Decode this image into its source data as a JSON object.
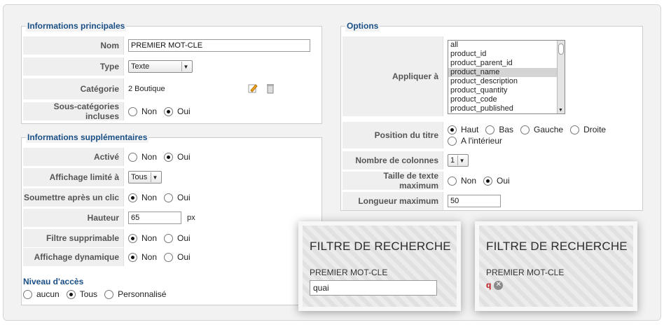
{
  "main_info": {
    "legend": "Informations principales",
    "name_label": "Nom",
    "name_value": "PREMIER MOT-CLE",
    "type_label": "Type",
    "type_value": "Texte",
    "category_label": "Catégorie",
    "category_value": "2 Boutique",
    "subcat_label": "Sous-catégories incluses",
    "subcat_no": "Non",
    "subcat_yes": "Oui"
  },
  "extra_info": {
    "legend": "Informations supplémentaires",
    "active_label": "Activé",
    "active_no": "Non",
    "active_yes": "Oui",
    "limit_label": "Affichage limité à",
    "limit_value": "Tous",
    "submit_label": "Soumettre après un clic",
    "submit_no": "Non",
    "submit_yes": "Oui",
    "height_label": "Hauteur",
    "height_value": "65",
    "height_unit": "px",
    "removable_label": "Filtre supprimable",
    "removable_no": "Non",
    "removable_yes": "Oui",
    "dynamic_label": "Affichage dynamique",
    "dynamic_no": "Non",
    "dynamic_yes": "Oui",
    "access_label": "Niveau d'accès",
    "access_none": "aucun",
    "access_all": "Tous",
    "access_custom": "Personnalisé"
  },
  "options": {
    "legend": "Options",
    "apply_label": "Appliquer à",
    "apply_items": [
      "all",
      "product_id",
      "product_parent_id",
      "product_name",
      "product_description",
      "product_quantity",
      "product_code",
      "product_published"
    ],
    "apply_selected": "product_name",
    "title_pos_label": "Position du titre",
    "pos_top": "Haut",
    "pos_bottom": "Bas",
    "pos_left": "Gauche",
    "pos_right": "Droite",
    "pos_inside": "A l'intérieur",
    "columns_label": "Nombre de colonnes",
    "columns_value": "1",
    "maxsize_label": "Taille de texte maximum",
    "maxsize_no": "Non",
    "maxsize_yes": "Oui",
    "maxlen_label": "Longueur maximum",
    "maxlen_value": "50"
  },
  "preview_left": {
    "title": "FILTRE DE RECHERCHE",
    "label": "PREMIER MOT-CLE",
    "input_value": "quai"
  },
  "preview_right": {
    "title": "FILTRE DE RECHERCHE",
    "label": "PREMIER MOT-CLE",
    "tag_value": "q"
  }
}
